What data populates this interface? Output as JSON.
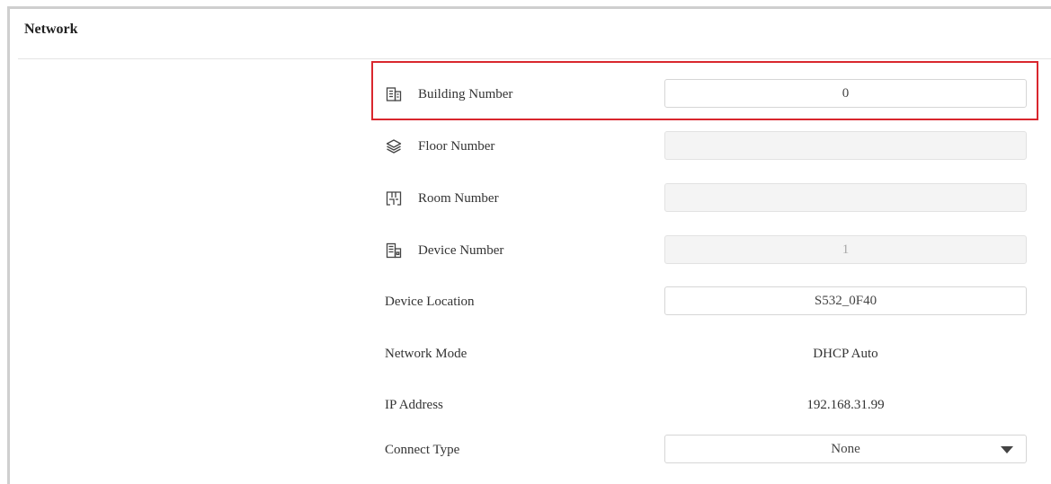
{
  "panel": {
    "title": "Network"
  },
  "rows": [
    {
      "label": "Building Number",
      "icon": "building-icon",
      "value": "0",
      "type": "input"
    },
    {
      "label": "Floor Number",
      "icon": "layers-icon",
      "value": "",
      "type": "input-disabled"
    },
    {
      "label": "Room Number",
      "icon": "room-icon",
      "value": "",
      "type": "input-disabled"
    },
    {
      "label": "Device Number",
      "icon": "device-icon",
      "value": "1",
      "type": "input-disabled"
    },
    {
      "label": "Device Location",
      "icon": "",
      "value": "S532_0F40",
      "type": "input"
    },
    {
      "label": "Network Mode",
      "icon": "",
      "value": "DHCP Auto",
      "type": "static"
    },
    {
      "label": "IP Address",
      "icon": "",
      "value": "192.168.31.99",
      "type": "static"
    },
    {
      "label": "Connect Type",
      "icon": "",
      "value": "None",
      "type": "select"
    }
  ],
  "colors": {
    "highlight": "#d9272e",
    "frame": "#cfcfcf",
    "disabled_bg": "#f4f4f4"
  }
}
